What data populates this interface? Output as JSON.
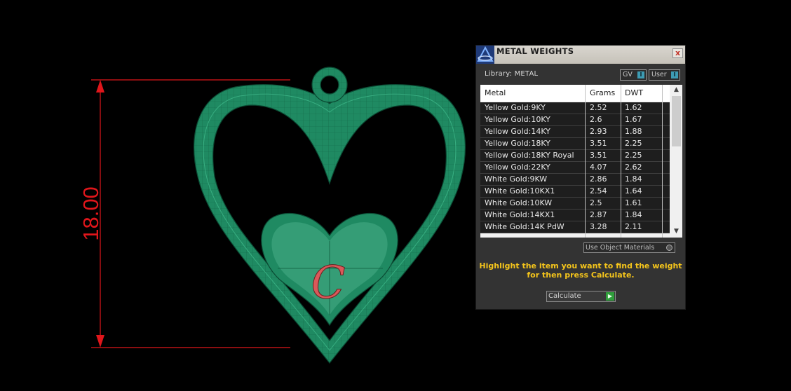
{
  "viewport": {
    "dimension_text": "18.00",
    "initial_letter": "C",
    "colors": {
      "model": "#1f8a62",
      "dimension": "#e0161b"
    }
  },
  "panel": {
    "title": "METAL WEIGHTS",
    "close_label": "x",
    "library_label": "Library: METAL",
    "toggles": [
      {
        "label": "GV",
        "indicator": "I"
      },
      {
        "label": "User",
        "indicator": "I"
      }
    ],
    "columns": [
      "Metal",
      "Grams",
      "DWT"
    ],
    "rows": [
      {
        "metal": "Yellow Gold:9KY",
        "grams": "2.52",
        "dwt": "1.62"
      },
      {
        "metal": "Yellow Gold:10KY",
        "grams": "2.6",
        "dwt": "1.67"
      },
      {
        "metal": "Yellow Gold:14KY",
        "grams": "2.93",
        "dwt": "1.88"
      },
      {
        "metal": "Yellow Gold:18KY",
        "grams": "3.51",
        "dwt": "2.25"
      },
      {
        "metal": "Yellow Gold:18KY Royal",
        "grams": "3.51",
        "dwt": "2.25"
      },
      {
        "metal": "Yellow Gold:22KY",
        "grams": "4.07",
        "dwt": "2.62"
      },
      {
        "metal": "White Gold:9KW",
        "grams": "2.86",
        "dwt": "1.84"
      },
      {
        "metal": "White Gold:10KX1",
        "grams": "2.54",
        "dwt": "1.64"
      },
      {
        "metal": "White Gold:10KW",
        "grams": "2.5",
        "dwt": "1.61"
      },
      {
        "metal": "White Gold:14KX1",
        "grams": "2.87",
        "dwt": "1.84"
      },
      {
        "metal": "White Gold:14K PdW",
        "grams": "3.28",
        "dwt": "2.11"
      }
    ],
    "use_object_materials_label": "Use Object Materials",
    "hint_line1": "Highlight the item you want to find the weight",
    "hint_line2": "for then press Calculate.",
    "calculate_label": "Calculate",
    "colors": {
      "accent": "#3d9bb3",
      "hint": "#f5c51b",
      "go": "#2f9e3b"
    }
  }
}
